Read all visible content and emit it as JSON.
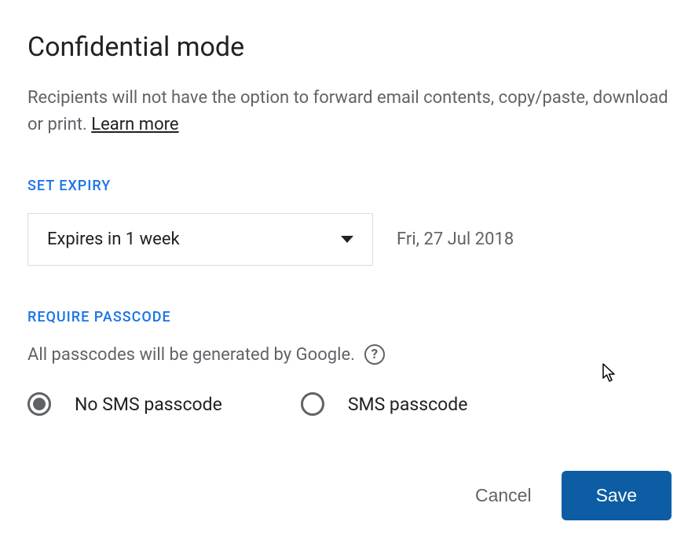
{
  "dialog": {
    "title": "Confidential mode",
    "description": "Recipients will not have the option to forward email contents, copy/paste, download or print. ",
    "learn_more": "Learn more"
  },
  "expiry": {
    "section_label": "SET EXPIRY",
    "selected": "Expires in 1 week",
    "date": "Fri, 27 Jul 2018"
  },
  "passcode": {
    "section_label": "REQUIRE PASSCODE",
    "description": "All passcodes will be generated by Google.",
    "help_symbol": "?",
    "options": {
      "no_sms": "No SMS passcode",
      "sms": "SMS passcode"
    },
    "selected": "no_sms"
  },
  "buttons": {
    "cancel": "Cancel",
    "save": "Save"
  },
  "colors": {
    "accent": "#1a73e8",
    "save_bg": "#0d5da5",
    "text_primary": "#202124",
    "text_secondary": "#5f6368",
    "border": "#dadce0"
  }
}
